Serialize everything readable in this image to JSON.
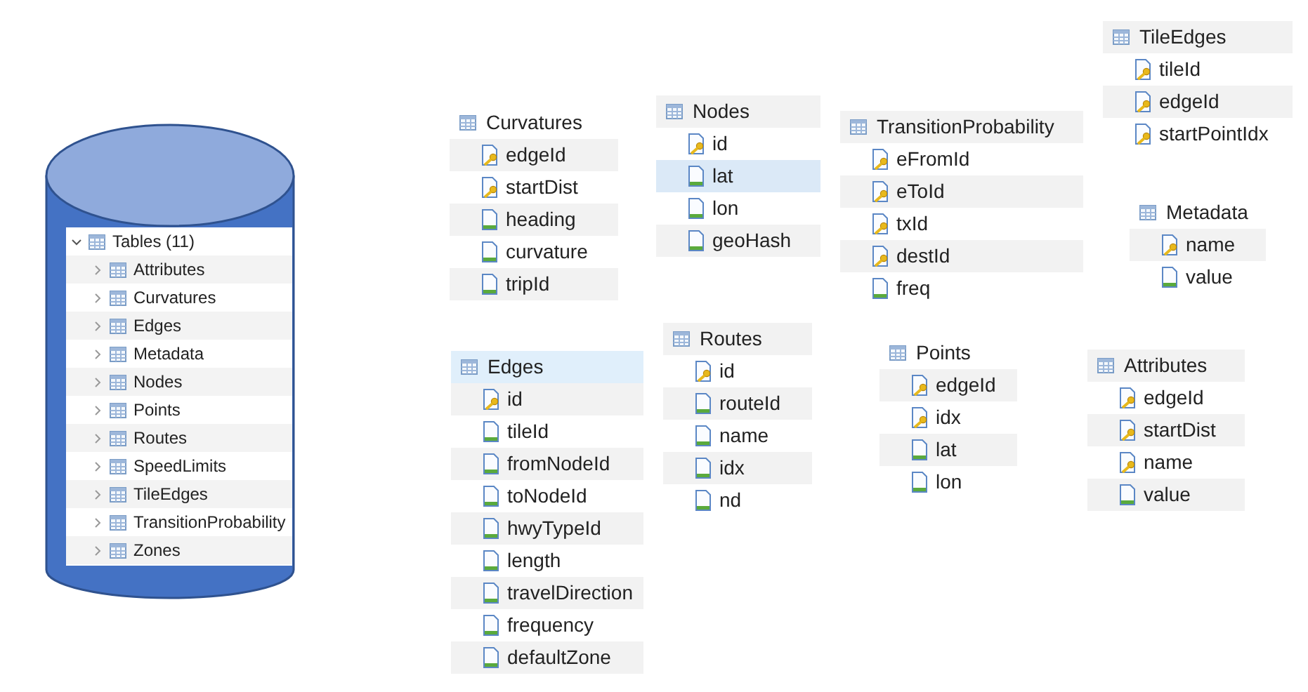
{
  "tree": {
    "label": "Tables (11)",
    "expanded": true,
    "children": [
      {
        "label": "Attributes",
        "expanded": false
      },
      {
        "label": "Curvatures",
        "expanded": false
      },
      {
        "label": "Edges",
        "expanded": false
      },
      {
        "label": "Metadata",
        "expanded": false
      },
      {
        "label": "Nodes",
        "expanded": false
      },
      {
        "label": "Points",
        "expanded": false
      },
      {
        "label": "Routes",
        "expanded": false
      },
      {
        "label": "SpeedLimits",
        "expanded": false
      },
      {
        "label": "TileEdges",
        "expanded": false
      },
      {
        "label": "TransitionProbability",
        "expanded": false
      },
      {
        "label": "Zones",
        "expanded": false
      }
    ]
  },
  "tables": [
    {
      "name": "Curvatures",
      "selected": false,
      "header_shaded": false,
      "columns": [
        {
          "name": "edgeId",
          "key": true,
          "selected": false
        },
        {
          "name": "startDist",
          "key": true,
          "selected": false
        },
        {
          "name": "heading",
          "key": false,
          "selected": false
        },
        {
          "name": "curvature",
          "key": false,
          "selected": false
        },
        {
          "name": "tripId",
          "key": false,
          "selected": false
        }
      ]
    },
    {
      "name": "Nodes",
      "selected": false,
      "header_shaded": true,
      "columns": [
        {
          "name": "id",
          "key": true,
          "selected": false
        },
        {
          "name": "lat",
          "key": false,
          "selected": true
        },
        {
          "name": "lon",
          "key": false,
          "selected": false
        },
        {
          "name": "geoHash",
          "key": false,
          "selected": false
        }
      ]
    },
    {
      "name": "TransitionProbability",
      "selected": false,
      "header_shaded": true,
      "columns": [
        {
          "name": "eFromId",
          "key": true,
          "selected": false
        },
        {
          "name": "eToId",
          "key": true,
          "selected": false
        },
        {
          "name": "txId",
          "key": true,
          "selected": false
        },
        {
          "name": "destId",
          "key": true,
          "selected": false
        },
        {
          "name": "freq",
          "key": false,
          "selected": false
        }
      ]
    },
    {
      "name": "TileEdges",
      "selected": false,
      "header_shaded": true,
      "columns": [
        {
          "name": "tileId",
          "key": true,
          "selected": false
        },
        {
          "name": "edgeId",
          "key": true,
          "selected": false
        },
        {
          "name": "startPointIdx",
          "key": true,
          "selected": false
        }
      ]
    },
    {
      "name": "Metadata",
      "selected": false,
      "header_shaded": false,
      "columns": [
        {
          "name": "name",
          "key": true,
          "selected": false
        },
        {
          "name": "value",
          "key": false,
          "selected": false
        }
      ]
    },
    {
      "name": "Edges",
      "selected": true,
      "header_shaded": false,
      "columns": [
        {
          "name": "id",
          "key": true,
          "selected": false
        },
        {
          "name": "tileId",
          "key": false,
          "selected": false
        },
        {
          "name": "fromNodeId",
          "key": false,
          "selected": false
        },
        {
          "name": "toNodeId",
          "key": false,
          "selected": false
        },
        {
          "name": "hwyTypeId",
          "key": false,
          "selected": false
        },
        {
          "name": "length",
          "key": false,
          "selected": false
        },
        {
          "name": "travelDirection",
          "key": false,
          "selected": false
        },
        {
          "name": "frequency",
          "key": false,
          "selected": false
        },
        {
          "name": "defaultZone",
          "key": false,
          "selected": false
        }
      ]
    },
    {
      "name": "Routes",
      "selected": false,
      "header_shaded": true,
      "columns": [
        {
          "name": "id",
          "key": true,
          "selected": false
        },
        {
          "name": "routeId",
          "key": false,
          "selected": false
        },
        {
          "name": "name",
          "key": false,
          "selected": false
        },
        {
          "name": "idx",
          "key": false,
          "selected": false
        },
        {
          "name": "nd",
          "key": false,
          "selected": false
        }
      ]
    },
    {
      "name": "Points",
      "selected": false,
      "header_shaded": false,
      "columns": [
        {
          "name": "edgeId",
          "key": true,
          "selected": false
        },
        {
          "name": "idx",
          "key": true,
          "selected": false
        },
        {
          "name": "lat",
          "key": false,
          "selected": false
        },
        {
          "name": "lon",
          "key": false,
          "selected": false
        }
      ]
    },
    {
      "name": "Attributes",
      "selected": false,
      "header_shaded": true,
      "columns": [
        {
          "name": "edgeId",
          "key": true,
          "selected": false
        },
        {
          "name": "startDist",
          "key": true,
          "selected": false
        },
        {
          "name": "name",
          "key": true,
          "selected": false
        },
        {
          "name": "value",
          "key": false,
          "selected": false
        }
      ]
    }
  ]
}
